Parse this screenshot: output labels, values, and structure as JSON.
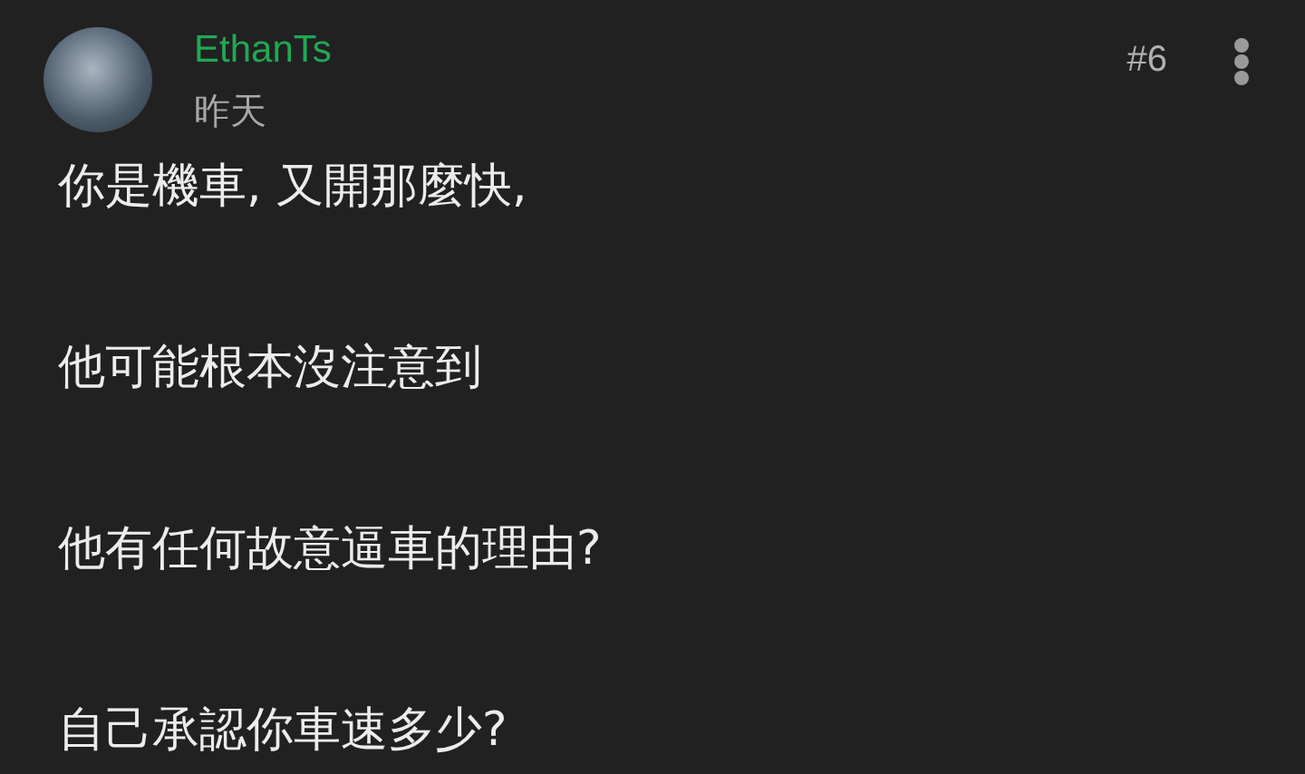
{
  "post": {
    "author": "EthanTs",
    "time": "昨天",
    "floor": "#6",
    "paragraphs": [
      "你是機車, 又開那麼快,",
      "他可能根本沒注意到",
      "他有任何故意逼車的理由?",
      "自己承認你車速多少?"
    ]
  }
}
